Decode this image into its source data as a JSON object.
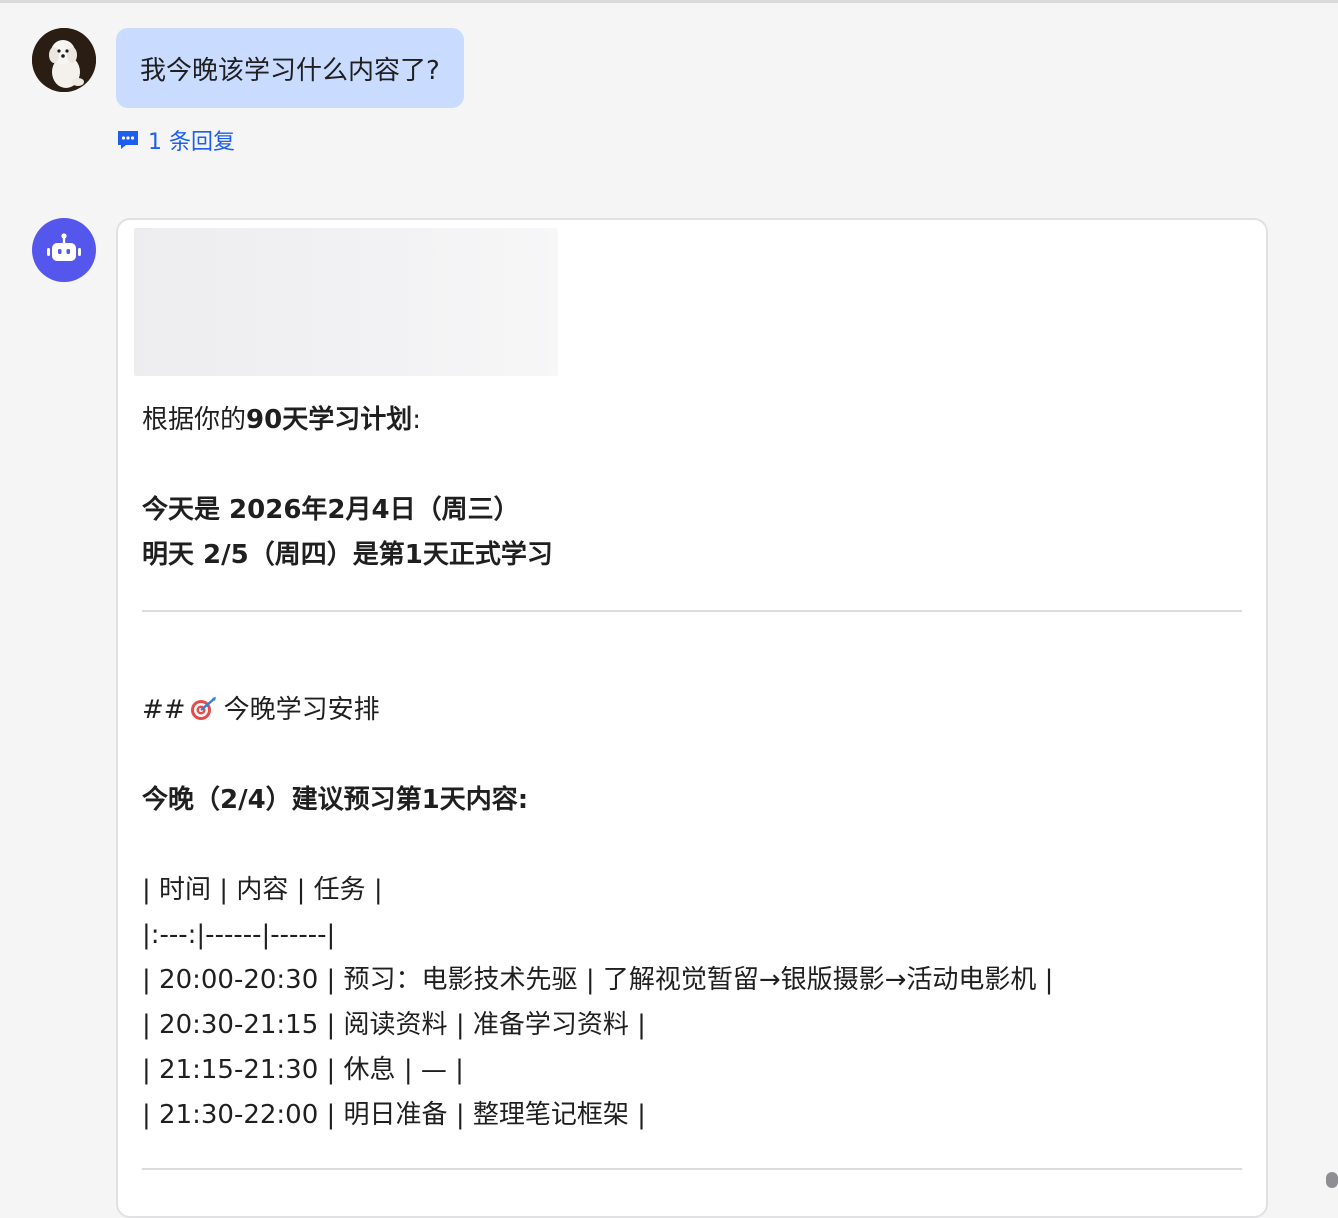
{
  "user_message": {
    "text": "我今晚该学习什么内容了?",
    "reply_count_label": "1 条回复"
  },
  "bot_message": {
    "intro_prefix": "根据你的",
    "intro_bold": "90天学习计划",
    "intro_suffix": ":",
    "today_line": "今天是 2026年2月4日（周三）",
    "tomorrow_line": "明天 2/5（周四）是第1天正式学习",
    "heading_prefix": "##",
    "heading_text": "今晚学习安排",
    "preview_line": "今晚（2/4）建议预习第1天内容:",
    "table_lines": [
      "| 时间 | 内容 | 任务 |",
      "|:---:|------|------|",
      "| 20:00-20:30 | 预习：电影技术先驱 | 了解视觉暂留→银版摄影→活动电影机 |",
      "| 20:30-21:15 | 阅读资料 | 准备学习资料 |",
      "| 21:15-21:30 | 休息 | — |",
      "| 21:30-22:00 | 明日准备 | 整理笔记框架 |"
    ]
  },
  "colors": {
    "user_bubble": "#c9dcff",
    "link": "#1d5ef0",
    "bot_avatar": "#5557ec"
  },
  "icons": [
    "user-avatar",
    "comment-icon",
    "robot-icon",
    "target-icon"
  ]
}
